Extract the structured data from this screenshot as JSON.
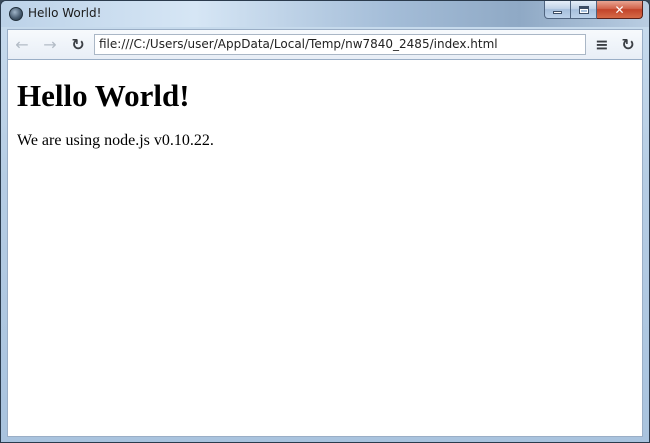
{
  "window": {
    "title": "Hello World!",
    "icon": "app-globe-icon",
    "buttons": {
      "minimize": "minimize-icon",
      "maximize": "maximize-icon",
      "close": "✕"
    }
  },
  "toolbar": {
    "back_icon": "←",
    "forward_icon": "→",
    "reload_icon": "↻",
    "menu_icon": "≡",
    "reload_right_icon": "↻",
    "address": "file:///C:/Users/user/AppData/Local/Temp/nw7840_2485/index.html"
  },
  "page": {
    "heading": "Hello World!",
    "paragraph": "We are using node.js v0.10.22."
  }
}
